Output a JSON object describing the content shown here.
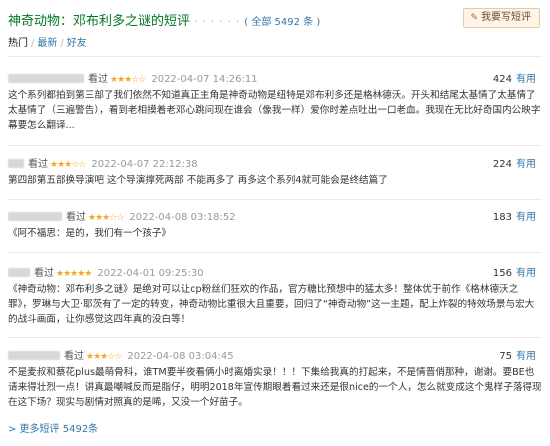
{
  "header": {
    "title": "神奇动物：邓布利多之谜的短评",
    "dots": "· · · · · ·",
    "total": "( 全部 5492 条 )",
    "write_button": "我要写短评"
  },
  "sorts": {
    "current": "热门",
    "sep1": "/",
    "latest": "最新",
    "sep2": "/",
    "friends": "好友"
  },
  "comments": [
    {
      "status": "看过",
      "stars": "★★★☆☆",
      "time": "2022-04-07 14:26:11",
      "votes": "424",
      "useful": "有用",
      "content": "这个系列都拍到第三部了我们依然不知道真正主角是神奇动物是纽特是邓布利多还是格林德沃。开头和结尾太基情了太基情了太基情了（三遍警告），看到老相摸着老邓心跳问现在谁会（像我一样）爱你时差点吐出一口老血。我现在无比好奇国内公映字幕要怎么翻译..."
    },
    {
      "status": "看过",
      "stars": "★★★☆☆",
      "time": "2022-04-07 22:12:38",
      "votes": "224",
      "useful": "有用",
      "content": "第四部第五部换导演吧 这个导演撑死两部 不能再多了 再多这个系列4就可能会是终结篇了"
    },
    {
      "status": "看过",
      "stars": "★★★☆☆",
      "time": "2022-04-08 03:18:52",
      "votes": "183",
      "useful": "有用",
      "content": "《阿不福思：是的，我们有一个孩子》"
    },
    {
      "status": "看过",
      "stars": "★★★★★",
      "time": "2022-04-01 09:25:30",
      "votes": "156",
      "useful": "有用",
      "content": "《神奇动物：邓布利多之谜》是绝对可以让cp粉丝们狂欢的作品，官方糖比预想中的猛太多！整体优于前作《格林德沃之罪》，罗琳与大卫·耶茨有了一定的转变，神奇动物比重很大且重要，回归了“神奇动物”这一主题，配上炸裂的特效场景与宏大的战斗画面，让你感觉这四年真的没白等！"
    },
    {
      "status": "看过",
      "stars": "★★★☆☆",
      "time": "2022-04-08 03:04:45",
      "votes": "75",
      "useful": "有用",
      "content": "不是麦叔和蔡花plus最萌骨科，谁TM要半夜看俩小时离婚实录！！！下集给我真的打起来，不是情晋俏那种，谢谢。要BE也请来得壮烈一点！讲真最嘲喊反而是脂仔，明明2018年宣传期眼着看过来还是很nice的一个人，怎么就变成这个鬼样子落得现在这下场？现实与剧情对照真的是唏，又没一个好苗子。"
    }
  ],
  "more_link": "> 更多短评 5492条"
}
